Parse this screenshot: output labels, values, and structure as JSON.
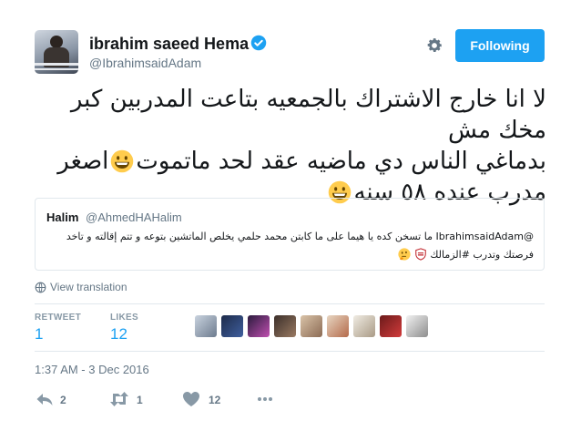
{
  "tweet": {
    "author_name": "ibrahim saeed Hema",
    "author_handle": "@IbrahimsaidAdam",
    "follow_label": "Following",
    "text_line1": "لا انا خارج الاشتراك بالجمعيه بتاعت المدربين كبر مخك مش",
    "text_line2_a": "بدماغي الناس دي ماضيه عقد لحد ماتموت",
    "text_line2_b": "اصغر",
    "text_line3": "مدرب عنده ٥٨ سنه",
    "view_translation": "View translation",
    "timestamp": "1:37 AM - 3 Dec 2016"
  },
  "quoted": {
    "name": "Halim",
    "handle": "@AhmedHAHalim",
    "text_line1": "@IbrahimsaidAdam ما تسخن كده يا هيما على ما كابتن محمد حلمي يخلص الماتشين بتوعه و تتم إقالته و تاخد",
    "text_line2": "فرصتك وتدرب #الزمالك"
  },
  "stats": {
    "retweet_label": "RETWEET",
    "retweet_count": "1",
    "likes_label": "LIKES",
    "likes_count": "12"
  },
  "actions": {
    "reply_count": "2",
    "retweet_count": "1",
    "like_count": "12"
  },
  "icons": [
    "verified-icon",
    "gear-icon",
    "globe-icon",
    "reply-icon",
    "retweet-icon",
    "heart-icon",
    "more-icon",
    "grinning-emoji-icon",
    "thinking-emoji-icon",
    "zamalek-badge-icon"
  ],
  "colors": {
    "accent": "#1da1f2",
    "secondary_text": "#657786",
    "border": "#e1e8ed",
    "emoji": "#ffcc4d"
  }
}
